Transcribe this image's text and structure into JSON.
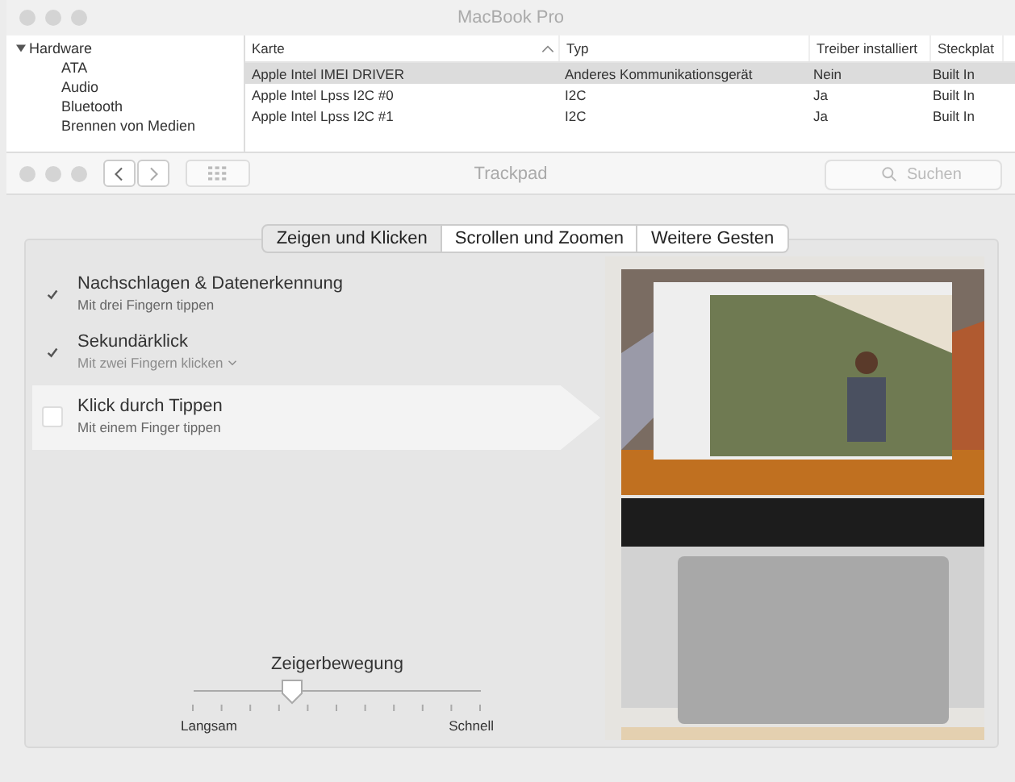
{
  "back_window": {
    "title": "MacBook Pro",
    "sidebar": {
      "items": [
        {
          "label": "Hardware",
          "expanded": true,
          "children": [
            {
              "label": "ATA"
            },
            {
              "label": "Audio"
            },
            {
              "label": "Bluetooth"
            },
            {
              "label": "Brennen von Medien"
            }
          ]
        }
      ]
    },
    "table": {
      "columns": [
        {
          "label": "Karte",
          "sorted": true
        },
        {
          "label": "Typ",
          "sorted": false
        },
        {
          "label": "Treiber installiert",
          "sorted": false
        },
        {
          "label": "Steckplat",
          "sorted": false
        }
      ],
      "rows": [
        {
          "cells": [
            "Apple Intel IMEI DRIVER",
            "Anderes Kommunikationsgerät",
            "Nein",
            "Built In"
          ],
          "selected": true
        },
        {
          "cells": [
            "Apple Intel Lpss I2C #0",
            "I2C",
            "Ja",
            "Built In"
          ],
          "selected": false
        },
        {
          "cells": [
            "Apple Intel Lpss I2C #1",
            "I2C",
            "Ja",
            "Built In"
          ],
          "selected": false
        }
      ]
    }
  },
  "window": {
    "title": "Trackpad",
    "search": {
      "placeholder": "Suchen"
    }
  },
  "tabs": [
    {
      "label": "Zeigen und Klicken",
      "selected": true
    },
    {
      "label": "Scrollen und Zoomen",
      "selected": false
    },
    {
      "label": "Weitere Gesten",
      "selected": false
    }
  ],
  "options": [
    {
      "title": "Nachschlagen & Datenerkennung",
      "subtitle": "Mit drei Fingern tippen",
      "kind": "text",
      "checked": true,
      "selected": false
    },
    {
      "title": "Sekundärklick",
      "subtitle": "Mit zwei Fingern klicken",
      "kind": "menu",
      "checked": true,
      "selected": false
    },
    {
      "title": "Klick durch Tippen",
      "subtitle": "Mit einem Finger tippen",
      "kind": "text",
      "checked": false,
      "selected": true
    }
  ],
  "slider": {
    "label": "Zeigerbewegung",
    "level": 0.34,
    "min_label": "Langsam",
    "max_label": "Schnell"
  }
}
